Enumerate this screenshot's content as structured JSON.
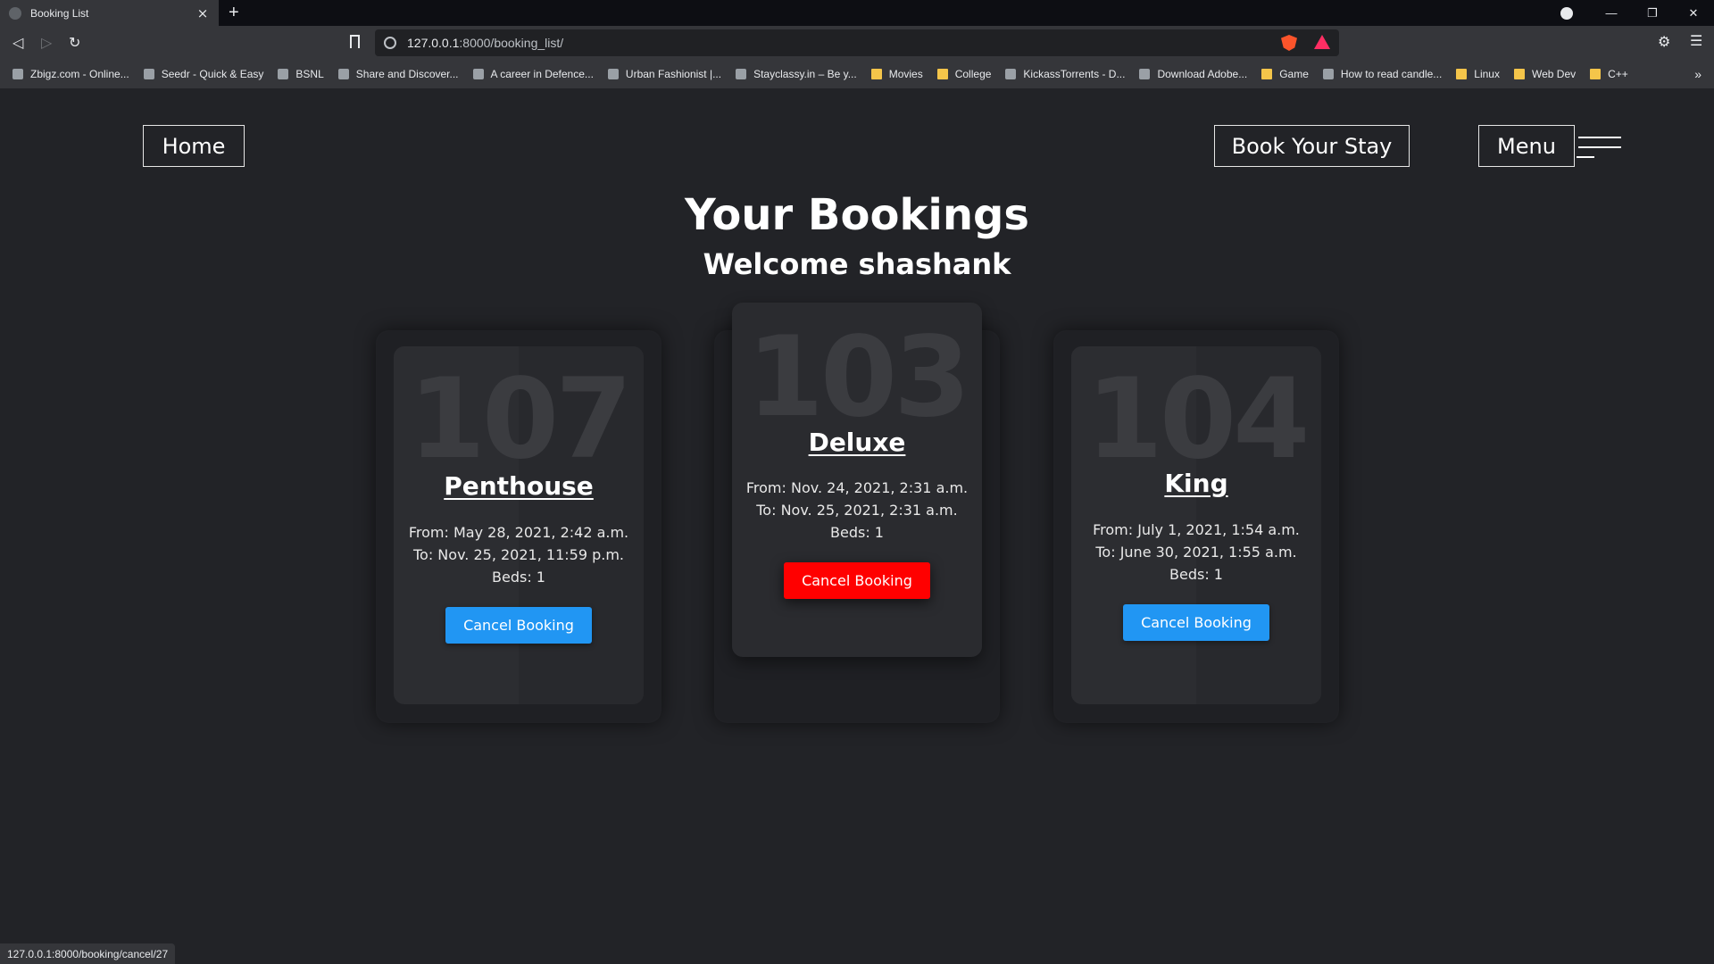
{
  "browser": {
    "tab_title": "Booking List",
    "tab_close": "×",
    "new_tab": "+",
    "url_host": "127.0.0.1",
    "url_rest": ":8000/booking_list/",
    "bookmarks": [
      {
        "label": "Zbigz.com - Online...",
        "icon": "cloud-icon"
      },
      {
        "label": "Seedr - Quick & Easy",
        "icon": "seedr-icon"
      },
      {
        "label": "BSNL",
        "icon": "bsnl-icon"
      },
      {
        "label": "Share and Discover...",
        "icon": "share-icon"
      },
      {
        "label": "A career in Defence...",
        "icon": "globe-icon"
      },
      {
        "label": "Urban Fashionist |...",
        "icon": "globe-icon"
      },
      {
        "label": "Stayclassy.in – Be y...",
        "icon": "stayclassy-icon"
      },
      {
        "label": "Movies",
        "icon": "folder-icon"
      },
      {
        "label": "College",
        "icon": "folder-icon"
      },
      {
        "label": "KickassTorrents - D...",
        "icon": "kickass-icon"
      },
      {
        "label": "Download Adobe...",
        "icon": "download-icon"
      },
      {
        "label": "Game",
        "icon": "folder-icon"
      },
      {
        "label": "How to read candle...",
        "icon": "chrome-icon"
      },
      {
        "label": "Linux",
        "icon": "folder-icon"
      },
      {
        "label": "Web Dev",
        "icon": "folder-icon"
      },
      {
        "label": "C++",
        "icon": "folder-icon"
      }
    ],
    "bookmarks_more": "»",
    "status_url": "127.0.0.1:8000/booking/cancel/27"
  },
  "nav": {
    "home_label": "Home",
    "book_label": "Book Your Stay",
    "menu_label": "Menu"
  },
  "page": {
    "title": "Your Bookings",
    "welcome": "Welcome shashank"
  },
  "bookings": [
    {
      "room_number": "107",
      "room_type": "Penthouse",
      "from": "From: May 28, 2021, 2:42 a.m.",
      "to": "To: Nov. 25, 2021, 11:59 p.m.",
      "beds": "Beds: 1",
      "cancel_label": "Cancel Booking"
    },
    {
      "room_number": "103",
      "room_type": "Deluxe",
      "from": "From: Nov. 24, 2021, 2:31 a.m.",
      "to": "To: Nov. 25, 2021, 2:31 a.m.",
      "beds": "Beds: 1",
      "cancel_label": "Cancel Booking"
    },
    {
      "room_number": "104",
      "room_type": "King",
      "from": "From: July 1, 2021, 1:54 a.m.",
      "to": "To: June 30, 2021, 1:55 a.m.",
      "beds": "Beds: 1",
      "cancel_label": "Cancel Booking"
    }
  ],
  "colors": {
    "background": "#222327",
    "cancel_button": "#2196f3",
    "cancel_button_hover": "#ff0000"
  }
}
